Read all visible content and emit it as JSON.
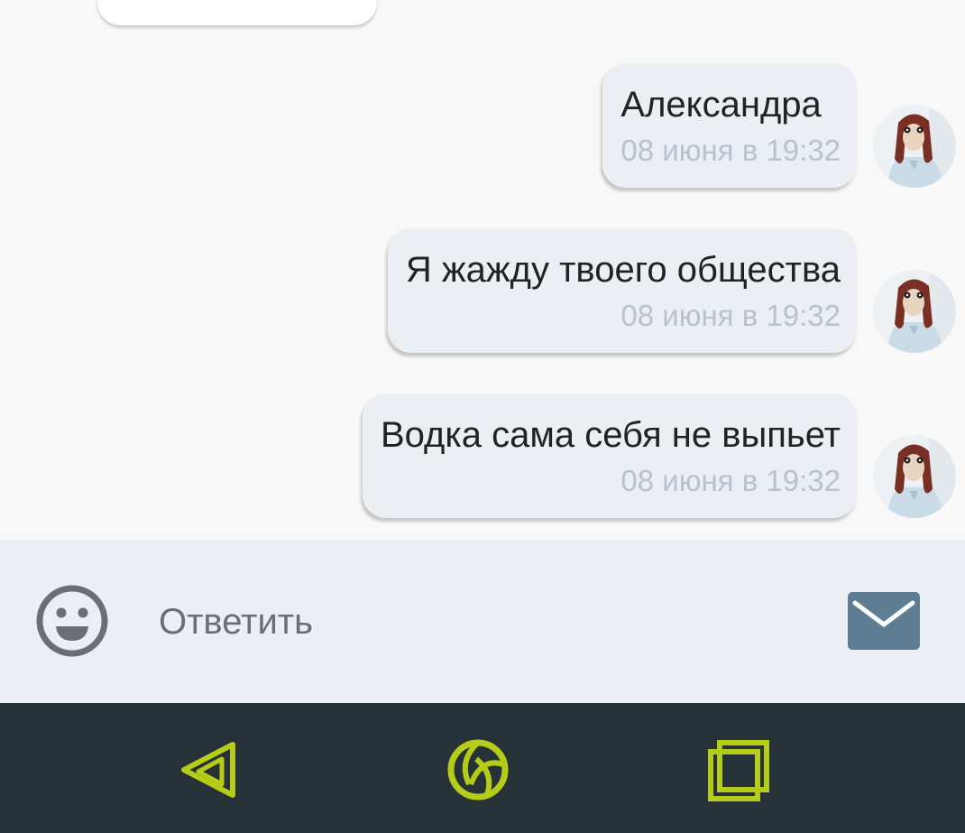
{
  "messages": [
    {
      "text": "Александра",
      "time": "08 июня в 19:32"
    },
    {
      "text": "Я жажду твоего общества",
      "time": "08 июня в 19:32"
    },
    {
      "text": "Водка сама себя не выпьет",
      "time": "08 июня в 19:32"
    }
  ],
  "composer": {
    "placeholder": "Ответить",
    "emoji_icon": "smiley-face-icon",
    "send_icon": "envelope-icon",
    "send_color": "#5e7d92"
  },
  "navbar": {
    "background": "#263238",
    "icon_color": "#b5cc18",
    "icons": [
      "back-triangle-icon",
      "home-ring-icon",
      "recents-square-icon"
    ]
  }
}
